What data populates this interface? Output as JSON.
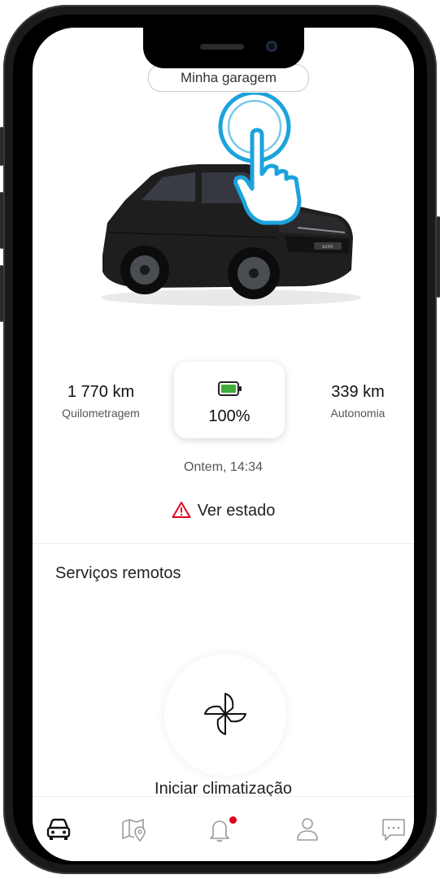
{
  "header": {
    "garage_label": "Minha garagem"
  },
  "vehicle": {
    "mileage_value": "1 770 km",
    "mileage_label": "Quilometragem",
    "battery_percent": "100%",
    "range_value": "339 km",
    "range_label": "Autonomia",
    "updated_at": "Ontem, 14:34",
    "status_link": "Ver estado",
    "plate_badge": "bZ4X"
  },
  "remote_services": {
    "title": "Serviços remotos",
    "climate_label": "Iniciar climatização"
  },
  "bottom_nav": {
    "items": [
      {
        "icon": "car-icon",
        "active": true
      },
      {
        "icon": "map-pin-icon",
        "active": false
      },
      {
        "icon": "bell-icon",
        "active": false,
        "notification": true
      },
      {
        "icon": "user-icon",
        "active": false
      },
      {
        "icon": "chat-icon",
        "active": false
      }
    ]
  },
  "colors": {
    "battery_green": "#3fae3a",
    "warning_red": "#e2001a",
    "tap_blue": "#1ca3dc",
    "notification_red": "#e2001a"
  }
}
